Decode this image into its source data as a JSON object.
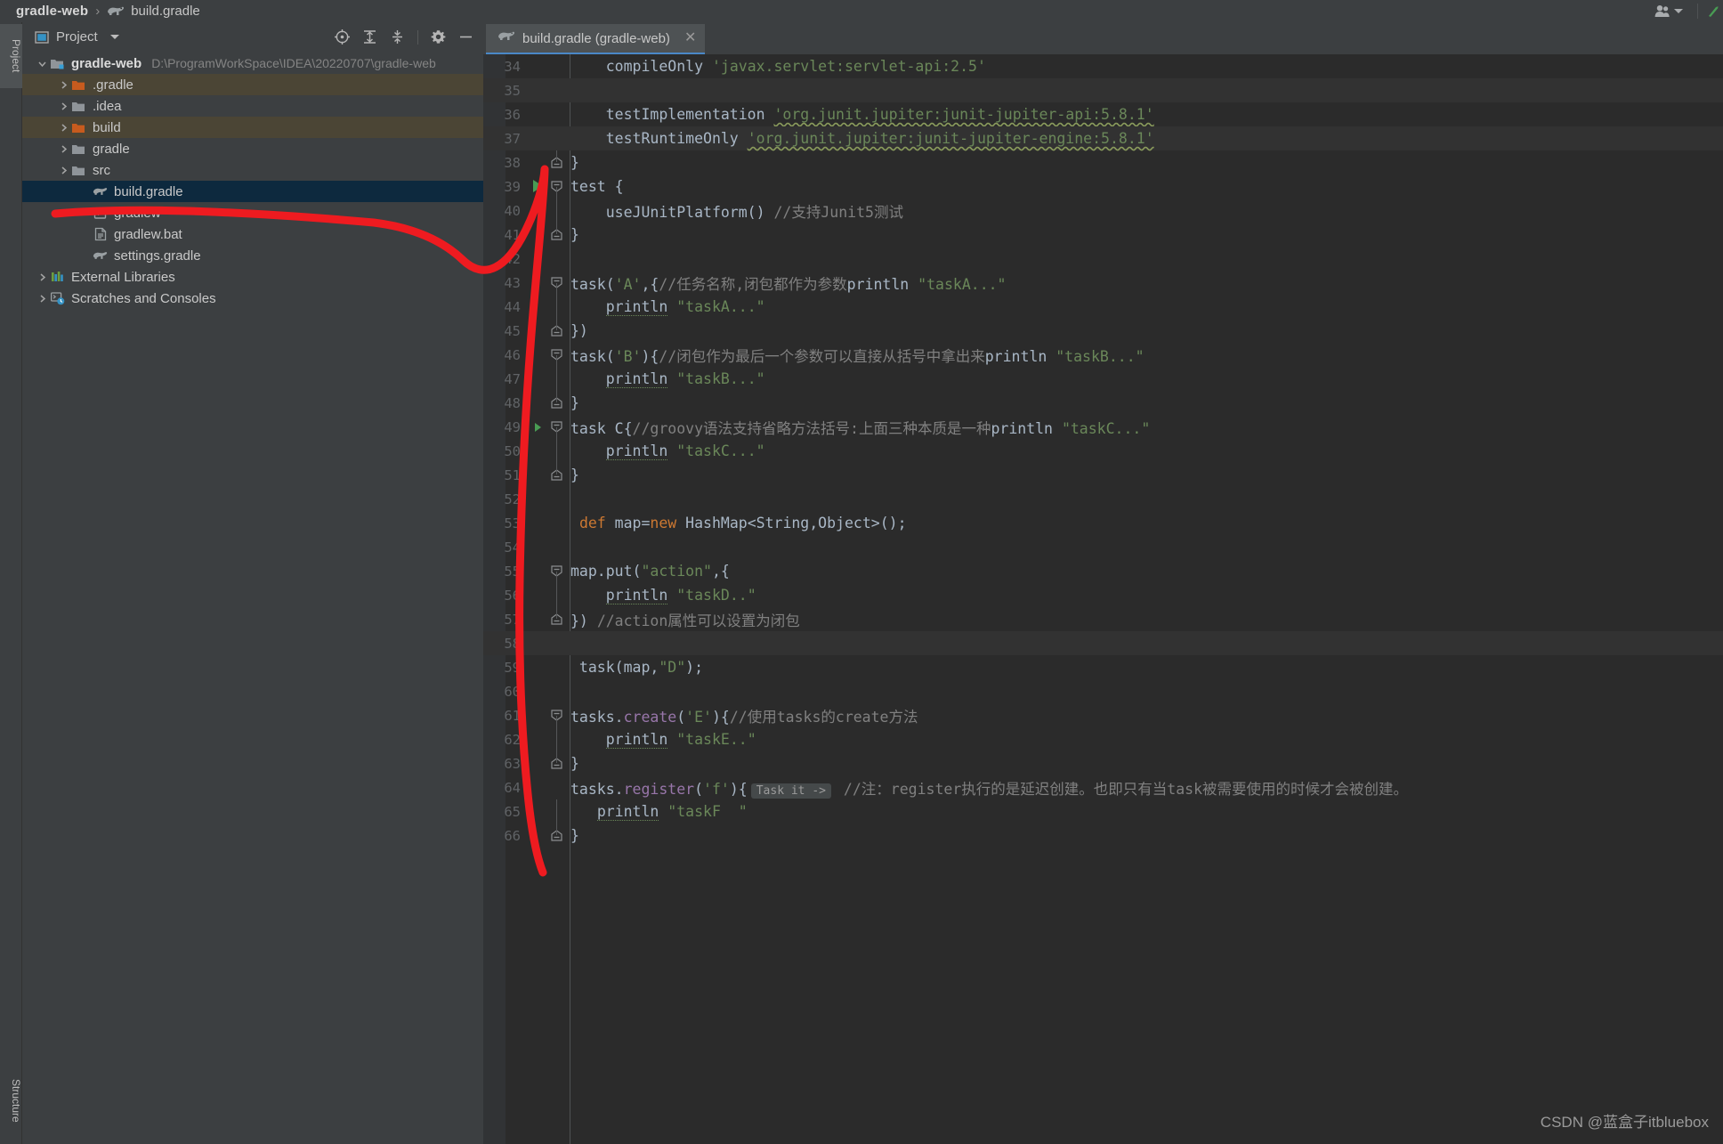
{
  "window": {
    "breadcrumb": {
      "project": "gradle-web",
      "separator": "›",
      "file": "build.gradle",
      "file_icon": "gradle-elephant-icon"
    },
    "top_right": {
      "account_icon": "user-account-icon",
      "account_dropdown_icon": "chevron-down-icon",
      "run_icon": "run-green-arrow-icon"
    }
  },
  "tool_strip": {
    "left_tabs": [
      {
        "label": "Project",
        "icon": "project-folder-icon",
        "active": true
      },
      {
        "label": "Structure",
        "icon": "structure-icon",
        "active": false
      }
    ]
  },
  "project_panel": {
    "header": {
      "icon": "project-view-icon",
      "title": "Project",
      "dropdown_icon": "chevron-down-icon",
      "tools": [
        {
          "name": "scroll-from-source-icon",
          "title": "Select Opened File"
        },
        {
          "name": "expand-all-icon",
          "title": "Expand All"
        },
        {
          "name": "collapse-all-icon",
          "title": "Collapse All"
        },
        {
          "name": "settings-gear-icon",
          "title": "Settings"
        },
        {
          "name": "hide-minimize-icon",
          "title": "Hide"
        }
      ]
    },
    "tree": [
      {
        "label": "gradle-web",
        "path": "D:\\ProgramWorkSpace\\IDEA\\20220707\\gradle-web",
        "depth": 0,
        "arrow": "down",
        "icon": "module-folder-icon",
        "bold": true,
        "state": "normal"
      },
      {
        "label": ".gradle",
        "path": "",
        "depth": 1,
        "arrow": "right",
        "icon": "folder-orange-icon",
        "bold": false,
        "state": "excluded"
      },
      {
        "label": ".idea",
        "path": "",
        "depth": 1,
        "arrow": "right",
        "icon": "folder-gray-icon",
        "bold": false,
        "state": "normal"
      },
      {
        "label": "build",
        "path": "",
        "depth": 1,
        "arrow": "right",
        "icon": "folder-orange-icon",
        "bold": false,
        "state": "excluded"
      },
      {
        "label": "gradle",
        "path": "",
        "depth": 1,
        "arrow": "right",
        "icon": "folder-gray-icon",
        "bold": false,
        "state": "normal"
      },
      {
        "label": "src",
        "path": "",
        "depth": 1,
        "arrow": "right",
        "icon": "folder-gray-icon",
        "bold": false,
        "state": "normal"
      },
      {
        "label": "build.gradle",
        "path": "",
        "depth": 2,
        "arrow": "none",
        "icon": "gradle-elephant-icon",
        "bold": false,
        "state": "selected"
      },
      {
        "label": "gradlew",
        "path": "",
        "depth": 2,
        "arrow": "none",
        "icon": "script-file-icon",
        "bold": false,
        "state": "normal"
      },
      {
        "label": "gradlew.bat",
        "path": "",
        "depth": 2,
        "arrow": "none",
        "icon": "bat-file-icon",
        "bold": false,
        "state": "normal"
      },
      {
        "label": "settings.gradle",
        "path": "",
        "depth": 2,
        "arrow": "none",
        "icon": "gradle-elephant-icon",
        "bold": false,
        "state": "normal"
      },
      {
        "label": "External Libraries",
        "path": "",
        "depth": 0,
        "arrow": "right",
        "icon": "libraries-icon",
        "bold": false,
        "state": "normal"
      },
      {
        "label": "Scratches and Consoles",
        "path": "",
        "depth": 0,
        "arrow": "right",
        "icon": "scratches-icon",
        "bold": false,
        "state": "normal"
      }
    ]
  },
  "editor": {
    "tab": {
      "icon": "gradle-elephant-icon",
      "label": "build.gradle (gradle-web)",
      "close_icon": "close-x-icon"
    },
    "lines": [
      {
        "n": "34",
        "indent": 2,
        "fold": "none",
        "gutter": "",
        "highlight": false,
        "changed": false,
        "tokens": [
          {
            "t": "    compileOnly ",
            "c": "s-def"
          },
          {
            "t": "'javax.servlet:servlet-api:2.5'",
            "c": "s-str"
          }
        ]
      },
      {
        "n": "35",
        "indent": 0,
        "fold": "none",
        "gutter": "",
        "highlight": true,
        "changed": false,
        "tokens": []
      },
      {
        "n": "36",
        "indent": 2,
        "fold": "none",
        "gutter": "",
        "highlight": false,
        "changed": false,
        "tokens": [
          {
            "t": "    testImplementation ",
            "c": "s-def"
          },
          {
            "t": "'org.junit.jupiter:junit-jupiter-api:5.8.1'",
            "c": "s-str wavy"
          }
        ]
      },
      {
        "n": "37",
        "indent": 2,
        "fold": "none",
        "gutter": "",
        "highlight": true,
        "changed": false,
        "tokens": [
          {
            "t": "    testRuntimeOnly ",
            "c": "s-def"
          },
          {
            "t": "'org.junit.jupiter:junit-jupiter-engine:5.8.1'",
            "c": "s-str wavy"
          }
        ]
      },
      {
        "n": "38",
        "indent": 0,
        "fold": "end",
        "gutter": "",
        "highlight": false,
        "changed": false,
        "tokens": [
          {
            "t": "}",
            "c": "s-def"
          }
        ]
      },
      {
        "n": "39",
        "indent": 0,
        "fold": "start",
        "gutter": "run-arrow",
        "highlight": false,
        "changed": false,
        "tokens": [
          {
            "t": "test {",
            "c": "s-def"
          }
        ]
      },
      {
        "n": "40",
        "indent": 1,
        "fold": "bar",
        "gutter": "",
        "highlight": false,
        "changed": false,
        "tokens": [
          {
            "t": "    useJUnitPlatform() ",
            "c": "s-def"
          },
          {
            "t": "//支持Junit5测试",
            "c": "s-cmt"
          }
        ]
      },
      {
        "n": "41",
        "indent": 0,
        "fold": "end",
        "gutter": "",
        "highlight": false,
        "changed": false,
        "tokens": [
          {
            "t": "}",
            "c": "s-def"
          }
        ]
      },
      {
        "n": "42",
        "indent": 0,
        "fold": "none",
        "gutter": "",
        "highlight": false,
        "changed": false,
        "tokens": []
      },
      {
        "n": "43",
        "indent": 0,
        "fold": "start",
        "gutter": "",
        "highlight": false,
        "changed": false,
        "tokens": [
          {
            "t": "task(",
            "c": "s-def"
          },
          {
            "t": "'A'",
            "c": "s-str"
          },
          {
            "t": ",{",
            "c": "s-def"
          },
          {
            "t": "//任务名称,闭包都作为参数",
            "c": "s-cmt"
          },
          {
            "t": "println ",
            "c": "s-def"
          },
          {
            "t": "\"taskA...\"",
            "c": "s-str"
          }
        ]
      },
      {
        "n": "44",
        "indent": 1,
        "fold": "bar",
        "gutter": "",
        "highlight": false,
        "changed": false,
        "tokens": [
          {
            "t": "    ",
            "c": "s-def"
          },
          {
            "t": "println",
            "c": "s-def dotted"
          },
          {
            "t": " ",
            "c": "s-def"
          },
          {
            "t": "\"taskA...\"",
            "c": "s-str"
          }
        ]
      },
      {
        "n": "45",
        "indent": 0,
        "fold": "end",
        "gutter": "",
        "highlight": false,
        "changed": false,
        "tokens": [
          {
            "t": "})",
            "c": "s-def"
          }
        ]
      },
      {
        "n": "46",
        "indent": 0,
        "fold": "start",
        "gutter": "",
        "highlight": false,
        "changed": false,
        "tokens": [
          {
            "t": "task(",
            "c": "s-def"
          },
          {
            "t": "'B'",
            "c": "s-str"
          },
          {
            "t": "){",
            "c": "s-def"
          },
          {
            "t": "//闭包作为最后一个参数可以直接从括号中拿出来",
            "c": "s-cmt"
          },
          {
            "t": "println ",
            "c": "s-def"
          },
          {
            "t": "\"taskB...\"",
            "c": "s-str"
          }
        ]
      },
      {
        "n": "47",
        "indent": 1,
        "fold": "bar",
        "gutter": "",
        "highlight": false,
        "changed": false,
        "tokens": [
          {
            "t": "    ",
            "c": "s-def"
          },
          {
            "t": "println",
            "c": "s-def dotted"
          },
          {
            "t": " ",
            "c": "s-def"
          },
          {
            "t": "\"taskB...\"",
            "c": "s-str"
          }
        ]
      },
      {
        "n": "48",
        "indent": 0,
        "fold": "end",
        "gutter": "",
        "highlight": false,
        "changed": false,
        "tokens": [
          {
            "t": "}",
            "c": "s-def"
          }
        ]
      },
      {
        "n": "49",
        "indent": 0,
        "fold": "start",
        "gutter": "run-arrow-small",
        "highlight": false,
        "changed": false,
        "tokens": [
          {
            "t": "task C{",
            "c": "s-def"
          },
          {
            "t": "//groovy语法支持省略方法括号:上面三种本质是一种",
            "c": "s-cmt"
          },
          {
            "t": "println ",
            "c": "s-def"
          },
          {
            "t": "\"taskC...\"",
            "c": "s-str"
          }
        ]
      },
      {
        "n": "50",
        "indent": 1,
        "fold": "bar",
        "gutter": "",
        "highlight": false,
        "changed": false,
        "tokens": [
          {
            "t": "    ",
            "c": "s-def"
          },
          {
            "t": "println",
            "c": "s-def dotted"
          },
          {
            "t": " ",
            "c": "s-def"
          },
          {
            "t": "\"taskC...\"",
            "c": "s-str"
          }
        ]
      },
      {
        "n": "51",
        "indent": 0,
        "fold": "end",
        "gutter": "",
        "highlight": false,
        "changed": false,
        "tokens": [
          {
            "t": "}",
            "c": "s-def"
          }
        ]
      },
      {
        "n": "52",
        "indent": 0,
        "fold": "none",
        "gutter": "",
        "highlight": false,
        "changed": false,
        "tokens": []
      },
      {
        "n": "53",
        "indent": 0,
        "fold": "none",
        "gutter": "",
        "highlight": false,
        "changed": false,
        "tokens": [
          {
            "t": " ",
            "c": "s-def"
          },
          {
            "t": "def",
            "c": "s-kw"
          },
          {
            "t": " map=",
            "c": "s-def"
          },
          {
            "t": "new",
            "c": "s-kw"
          },
          {
            "t": " HashMap<String,Object>();",
            "c": "s-def"
          }
        ]
      },
      {
        "n": "54",
        "indent": 0,
        "fold": "none",
        "gutter": "",
        "highlight": false,
        "changed": false,
        "tokens": []
      },
      {
        "n": "55",
        "indent": 0,
        "fold": "start",
        "gutter": "",
        "highlight": false,
        "changed": false,
        "tokens": [
          {
            "t": "map.put(",
            "c": "s-def"
          },
          {
            "t": "\"action\"",
            "c": "s-str"
          },
          {
            "t": ",{",
            "c": "s-def"
          }
        ]
      },
      {
        "n": "56",
        "indent": 1,
        "fold": "bar",
        "gutter": "",
        "highlight": false,
        "changed": false,
        "tokens": [
          {
            "t": "    ",
            "c": "s-def"
          },
          {
            "t": "println",
            "c": "s-def dotted"
          },
          {
            "t": " ",
            "c": "s-def"
          },
          {
            "t": "\"taskD..\"",
            "c": "s-str"
          }
        ]
      },
      {
        "n": "57",
        "indent": 0,
        "fold": "end",
        "gutter": "",
        "highlight": false,
        "changed": false,
        "tokens": [
          {
            "t": "}) ",
            "c": "s-def"
          },
          {
            "t": "//action属性可以设置为闭包",
            "c": "s-cmt"
          }
        ]
      },
      {
        "n": "58",
        "indent": 0,
        "fold": "none",
        "gutter": "",
        "highlight": true,
        "changed": false,
        "tokens": []
      },
      {
        "n": "59",
        "indent": 0,
        "fold": "none",
        "gutter": "",
        "highlight": false,
        "changed": false,
        "tokens": [
          {
            "t": " task(map,",
            "c": "s-def"
          },
          {
            "t": "\"D\"",
            "c": "s-str"
          },
          {
            "t": ");",
            "c": "s-def"
          }
        ]
      },
      {
        "n": "60",
        "indent": 0,
        "fold": "none",
        "gutter": "",
        "highlight": false,
        "changed": false,
        "tokens": []
      },
      {
        "n": "61",
        "indent": 0,
        "fold": "start",
        "gutter": "",
        "highlight": false,
        "changed": false,
        "tokens": [
          {
            "t": "tasks.",
            "c": "s-def"
          },
          {
            "t": "create",
            "c": "s-fn"
          },
          {
            "t": "(",
            "c": "s-def"
          },
          {
            "t": "'E'",
            "c": "s-str"
          },
          {
            "t": "){",
            "c": "s-def"
          },
          {
            "t": "//使用tasks的create方法",
            "c": "s-cmt"
          }
        ]
      },
      {
        "n": "62",
        "indent": 1,
        "fold": "bar",
        "gutter": "",
        "highlight": false,
        "changed": false,
        "tokens": [
          {
            "t": "    ",
            "c": "s-def"
          },
          {
            "t": "println",
            "c": "s-def dotted"
          },
          {
            "t": " ",
            "c": "s-def"
          },
          {
            "t": "\"taskE..\"",
            "c": "s-str"
          }
        ]
      },
      {
        "n": "63",
        "indent": 0,
        "fold": "end",
        "gutter": "",
        "highlight": false,
        "changed": false,
        "tokens": [
          {
            "t": "}",
            "c": "s-def"
          }
        ]
      },
      {
        "n": "64",
        "indent": 0,
        "fold": "none",
        "gutter": "",
        "highlight": false,
        "changed": false,
        "tokens": [
          {
            "t": "tasks.",
            "c": "s-def"
          },
          {
            "t": "register",
            "c": "s-fn"
          },
          {
            "t": "(",
            "c": "s-def"
          },
          {
            "t": "'f'",
            "c": "s-str"
          },
          {
            "t": "){",
            "c": "s-def"
          },
          {
            "t": "Task it ->",
            "c": "inlay"
          },
          {
            "t": " //注：register执行的是延迟创建。也即只有当task被需要使用的时候才会被创建。",
            "c": "s-cmt"
          }
        ]
      },
      {
        "n": "65",
        "indent": 1,
        "fold": "bar2",
        "gutter": "",
        "highlight": false,
        "changed": false,
        "tokens": [
          {
            "t": "   ",
            "c": "s-def"
          },
          {
            "t": "println",
            "c": "s-def dotted"
          },
          {
            "t": " ",
            "c": "s-def"
          },
          {
            "t": "\"taskF  \"",
            "c": "s-str"
          }
        ]
      },
      {
        "n": "66",
        "indent": 0,
        "fold": "end",
        "gutter": "",
        "highlight": false,
        "changed": false,
        "tokens": [
          {
            "t": "}",
            "c": "s-def"
          }
        ]
      }
    ]
  },
  "annotation": {
    "type": "red-pen-stroke",
    "color": "#ee1b20"
  },
  "watermark": {
    "text": "CSDN @蓝盒子itbluebox"
  },
  "colors": {
    "panel_bg": "#3c3f41",
    "editor_bg": "#2b2b2b",
    "gutter_bg": "#313335",
    "selection_bg": "#0d293e",
    "excluded_bg": "#4b4535",
    "tab_active_bg": "#4e5254",
    "tab_underline": "#4a88c7",
    "string": "#6a8759",
    "keyword": "#cc7832",
    "comment": "#808080",
    "method": "#ffc66d",
    "function": "#9876aa",
    "default_text": "#a9b7c6",
    "line_number": "#606366",
    "run_green": "#499c54"
  }
}
